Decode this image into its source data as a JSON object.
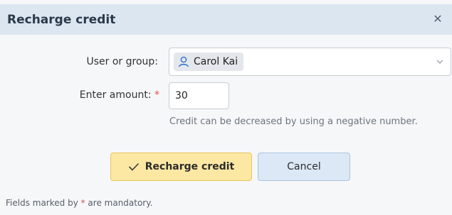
{
  "dialog": {
    "title": "Recharge credit",
    "close_icon": "close-icon"
  },
  "form": {
    "user_label": "User or group:",
    "user_value": "Carol Kai",
    "user_icon": "user-icon",
    "amount_label": "Enter amount:",
    "required_marker": "*",
    "amount_value": "30",
    "amount_hint": "Credit can be decreased by using a negative number."
  },
  "buttons": {
    "recharge_label": "Recharge credit",
    "recharge_icon": "check-icon",
    "cancel_label": "Cancel"
  },
  "footer": {
    "prefix": "Fields marked by ",
    "star": "*",
    "suffix": " are mandatory."
  },
  "colors": {
    "title_bar_bg": "#dce6f1",
    "primary_button_bg": "#fce8a3",
    "secondary_button_bg": "#dce8f6",
    "required_star": "#d9534f"
  }
}
